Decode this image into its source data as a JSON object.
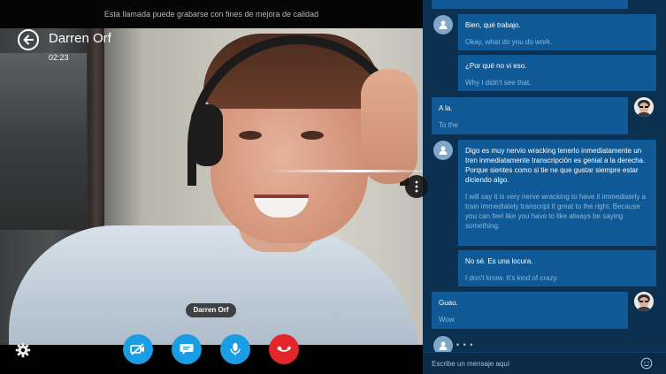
{
  "call": {
    "notice": "Esta llamada puede grabarse con fines de mejora de calidad",
    "caller_name": "Darren Orf",
    "duration": "02:23",
    "video_name_tag": "Darren Orf"
  },
  "controls": {
    "icons": [
      "video-off-icon",
      "chat-bubble-icon",
      "microphone-icon",
      "end-call-icon",
      "gear-icon",
      "more-vertical-icon",
      "back-arrow-icon"
    ]
  },
  "chat": {
    "messages": [
      {
        "from": "remote",
        "original": "Bien, qué trabajo.",
        "translation": "Okay, what do you do work."
      },
      {
        "from": "remote",
        "original": "¿Por qué no vi eso.",
        "translation": "Why I didn't see that."
      },
      {
        "from": "self",
        "original": "A la.",
        "translation": "To the"
      },
      {
        "from": "remote",
        "original": "Digo es muy nervio wracking tenerlo inmediatamente un tren inmediatamente transcripción es genial a la derecha. Porque sientes como si tie ne que gustar siempre estar diciendo algo.",
        "translation": "I will say it is very nerve wracking to have it immediately a train immediately transcript it great to the right. Because you can feel like you have to like always be saying something."
      },
      {
        "from": "remote",
        "original": "No sé. Es una locura.",
        "translation": "I don't know. It's kind of crazy."
      },
      {
        "from": "self",
        "original": "Guau.",
        "translation": "Wow"
      }
    ],
    "typing_indicator": "• • •",
    "composer_placeholder": "Escribe un mensaje aquí"
  },
  "colors": {
    "chat_background": "#0b3050",
    "bubble": "#0f5a96",
    "translation_text": "#8ab8de",
    "call_button_blue": "#1a9de2",
    "end_call_red": "#e3262a"
  }
}
